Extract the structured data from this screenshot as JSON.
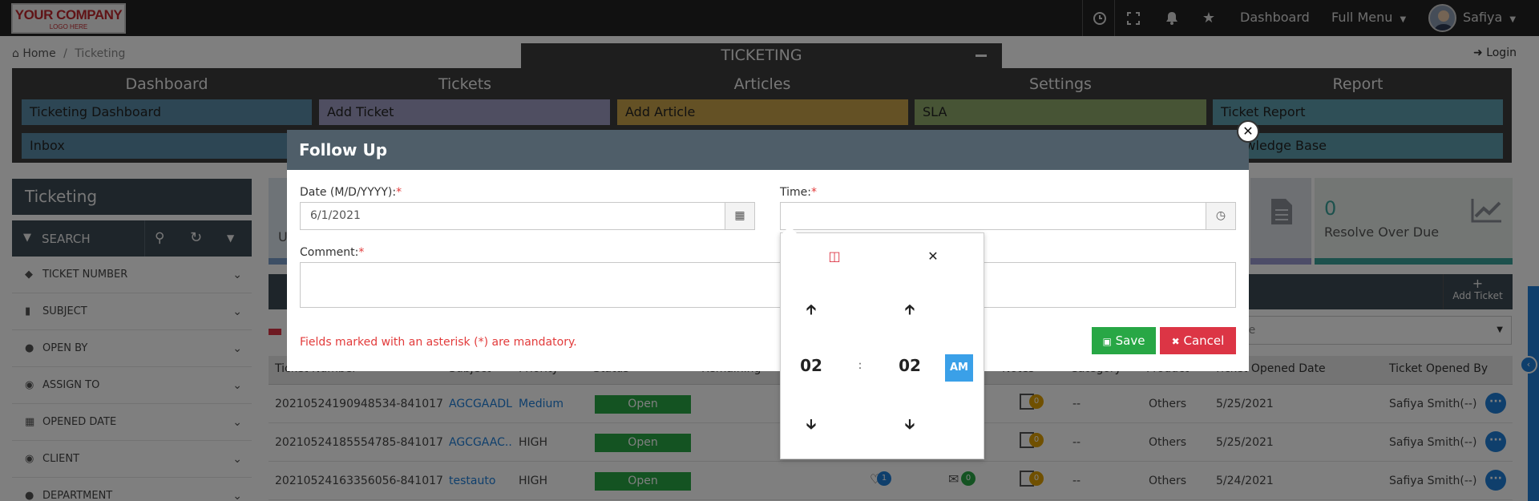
{
  "header": {
    "logo_text": "YOUR COMPANY",
    "logo_sub": "LOGO HERE",
    "dashboard_link": "Dashboard",
    "full_menu": "Full Menu",
    "user_name": "Safiya"
  },
  "breadcrumb": {
    "home": "Home",
    "separator": "/",
    "current": "Ticketing"
  },
  "login_link": "Login",
  "module": {
    "title": "TICKETING",
    "columns": [
      {
        "heading": "Dashboard",
        "items": [
          "Ticketing Dashboard",
          "Inbox"
        ],
        "color": "#5b8da8"
      },
      {
        "heading": "Tickets",
        "items": [
          "Add Ticket"
        ],
        "color": "#9e9cc2"
      },
      {
        "heading": "Articles",
        "items": [
          "Add Article"
        ],
        "color": "#c9a24a"
      },
      {
        "heading": "Settings",
        "items": [
          "SLA"
        ],
        "color": "#8ea86a"
      },
      {
        "heading": "Report",
        "items": [
          "Ticket Report",
          "Knowledge Base"
        ],
        "color": "#5e9fae"
      }
    ]
  },
  "sidebar": {
    "title": "Ticketing",
    "search_label": "SEARCH",
    "filters": [
      "TICKET NUMBER",
      "SUBJECT",
      "OPEN BY",
      "ASSIGN TO",
      "OPENED DATE",
      "CLIENT",
      "DEPARTMENT"
    ]
  },
  "stats": {
    "right_value": "0",
    "right_label": "Resolve Over Due",
    "left_partial": "U"
  },
  "toolbar": {
    "add_ticket": "Add Ticket",
    "select_text": "line"
  },
  "table": {
    "headers": [
      "Ticket Number",
      "Subject",
      "Priority",
      "Status",
      "Remaining",
      "Notes",
      "Category",
      "Product",
      "Ticket Opened Date",
      "Ticket Opened By"
    ],
    "rows": [
      {
        "number": "20210524190948534-841017",
        "subject": "AGCGAADL",
        "priority": "Medium",
        "status": "Open",
        "notes": "0",
        "category": "--",
        "product": "Others",
        "opened_date": "5/25/2021",
        "opened_by": "Safiya Smith(--)"
      },
      {
        "number": "20210524185554785-841017",
        "subject": "AGCGAAC..",
        "priority": "HIGH",
        "status": "Open",
        "notes": "0",
        "category": "--",
        "product": "Others",
        "opened_date": "5/25/2021",
        "opened_by": "Safiya Smith(--)"
      },
      {
        "number": "20210524163356056-841017",
        "subject": "testauto",
        "priority": "HIGH",
        "status": "Open",
        "likes": "1",
        "comments": "0",
        "notes": "0",
        "category": "--",
        "product": "Others",
        "opened_date": "5/24/2021",
        "opened_by": "Safiya Smith(--)"
      }
    ]
  },
  "modal": {
    "title": "Follow Up",
    "date_label": "Date (M/D/YYYY):",
    "date_value": "6/1/2021",
    "time_label": "Time:",
    "time_value": "",
    "comment_label": "Comment:",
    "required_mark": "*",
    "mandatory_note": "Fields marked with an asterisk (*) are mandatory.",
    "save_label": "Save",
    "cancel_label": "Cancel"
  },
  "time_picker": {
    "hour": "02",
    "minute": "02",
    "separator": ":",
    "meridiem": "AM"
  }
}
